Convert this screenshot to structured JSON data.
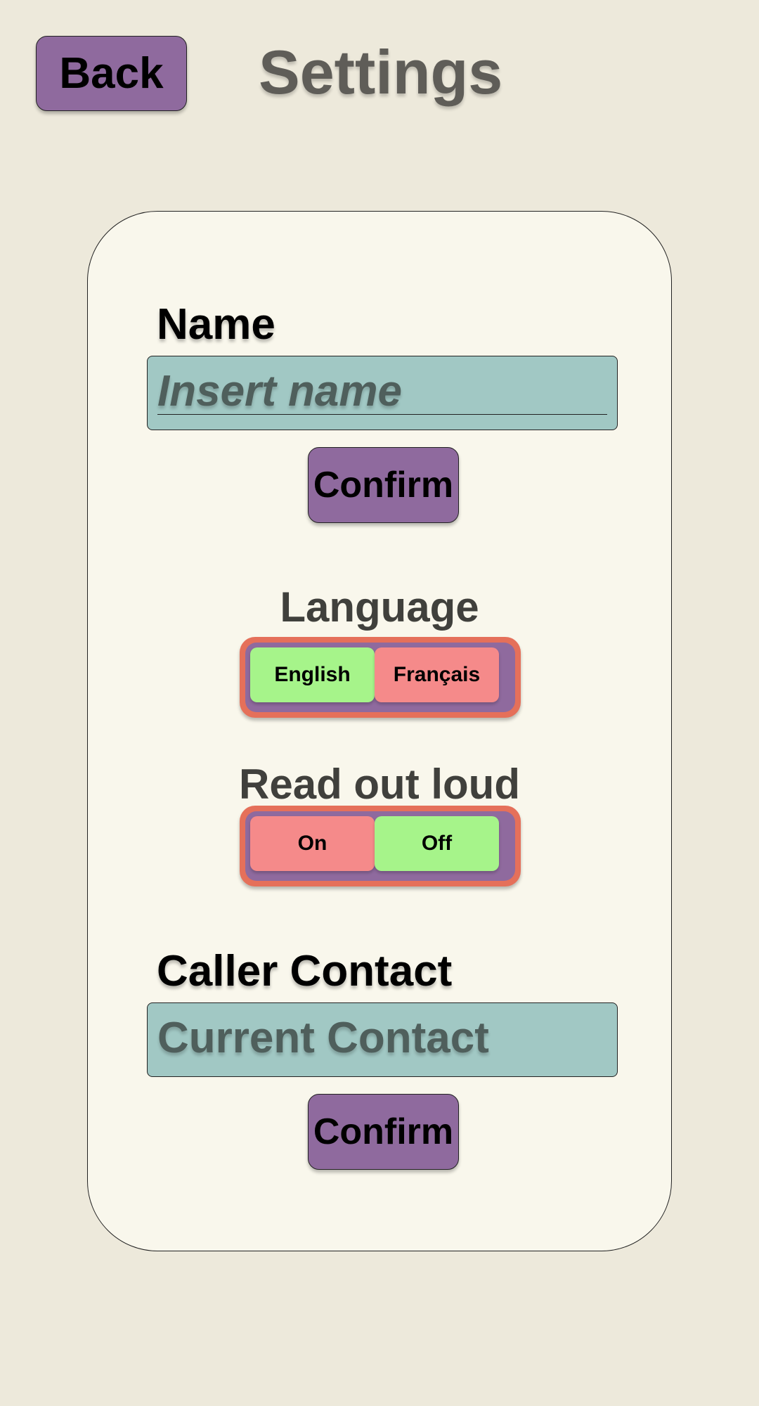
{
  "header": {
    "back_label": "Back",
    "title": "Settings"
  },
  "name_section": {
    "label": "Name",
    "placeholder": "Insert name",
    "confirm_label": "Confirm"
  },
  "language": {
    "label": "Language",
    "options": [
      {
        "label": "English",
        "selected": true
      },
      {
        "label": "Français",
        "selected": false
      }
    ]
  },
  "read_out_loud": {
    "label": "Read out loud",
    "options": [
      {
        "label": "On",
        "selected": false
      },
      {
        "label": "Off",
        "selected": true
      }
    ]
  },
  "caller_contact": {
    "label": "Caller Contact",
    "value": "Current Contact",
    "confirm_label": "Confirm"
  },
  "colors": {
    "background": "#ede9db",
    "card": "#f9f7ec",
    "button": "#8f6a9e",
    "input": "#a1c8c4",
    "selected": "#a6f48a",
    "unselected": "#f58a8a",
    "toggle_border": "#e5705a"
  }
}
